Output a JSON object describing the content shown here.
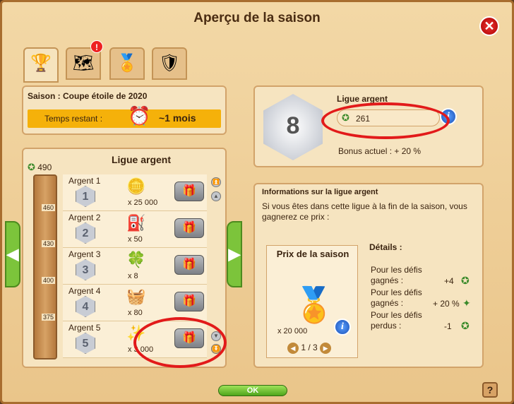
{
  "window": {
    "title": "Aperçu de la saison",
    "close_glyph": "✕",
    "ok_label": "OK",
    "help_glyph": "?"
  },
  "tabs": [
    {
      "name": "season-overview-tab",
      "icon": "trophy-icon",
      "glyph": "🏆"
    },
    {
      "name": "tasks-tab",
      "icon": "map-icon",
      "glyph": "🗺",
      "badge": "!"
    },
    {
      "name": "rewards-tab",
      "icon": "cup-icon",
      "glyph": "🏅"
    },
    {
      "name": "league-tab",
      "icon": "shield-icon",
      "glyph": "🛡"
    }
  ],
  "season": {
    "label": "Saison : Coupe étoile de 2020",
    "time_label": "Temps restant :",
    "time_value": "~1 mois"
  },
  "ladder": {
    "title": "Ligue argent",
    "current_score": "490",
    "ticks": [
      "460",
      "430",
      "400",
      "375"
    ],
    "rows": [
      {
        "name": "Argent 1",
        "level": "1",
        "qty": "x 25 000",
        "reward_icon": "gold-coin-icon",
        "glyph": "🪙"
      },
      {
        "name": "Argent 2",
        "level": "2",
        "qty": "x 50",
        "reward_icon": "fuel-can-icon",
        "glyph": "⛽"
      },
      {
        "name": "Argent 3",
        "level": "3",
        "qty": "x 8",
        "reward_icon": "clover-token-icon",
        "glyph": "🍀"
      },
      {
        "name": "Argent 4",
        "level": "4",
        "qty": "x 80",
        "reward_icon": "fruit-basket-icon",
        "glyph": "🧺"
      },
      {
        "name": "Argent 5",
        "level": "5",
        "qty": "x 3 000",
        "reward_icon": "sparkle-coin-icon",
        "glyph": "✨"
      }
    ],
    "gift_glyph": "🎁"
  },
  "league": {
    "name": "Ligue argent",
    "rank": "8",
    "points": "261",
    "bonus": "Bonus actuel :  + 20 %"
  },
  "info": {
    "title": "Informations sur la ligue argent",
    "text": "Si vous êtes dans cette ligue à la fin de la saison, vous gagnerez ce prix :",
    "prize_title": "Prix de la saison",
    "prize_qty": "x 20 000",
    "pager": "1 / 3",
    "details_title": "Détails :",
    "details": [
      {
        "label": "Pour les défis gagnés :",
        "value": "+4"
      },
      {
        "label": "Pour les défis gagnés :",
        "value": "+ 20 %"
      },
      {
        "label": "Pour les défis perdus :",
        "value": "-1"
      }
    ]
  }
}
